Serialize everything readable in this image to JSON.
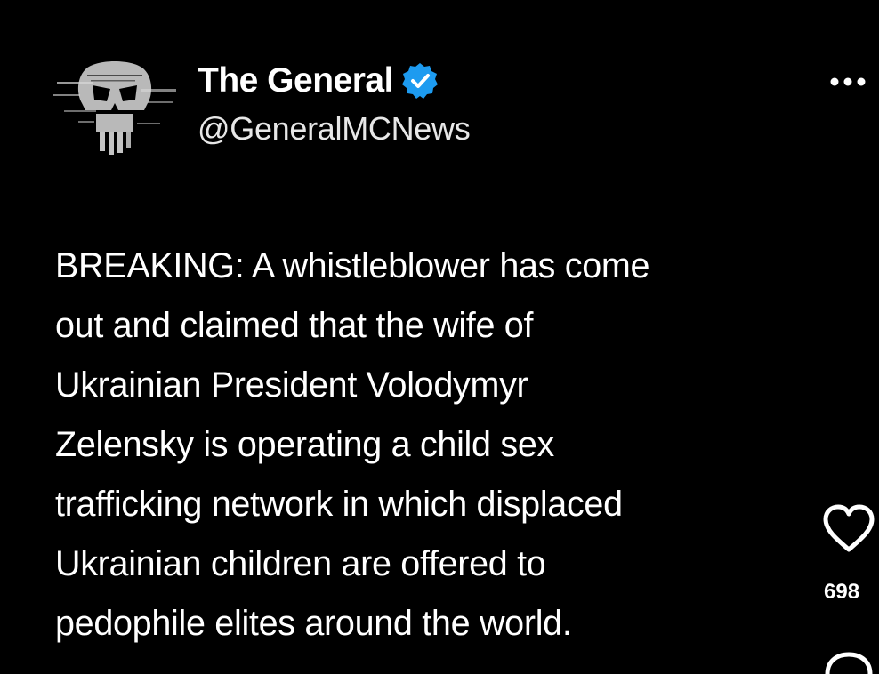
{
  "post": {
    "author": {
      "display_name": "The General",
      "handle": "@GeneralMCNews",
      "verified": true,
      "avatar_icon": "skull-logo"
    },
    "more_icon": "more-horizontal-icon",
    "text_lines": [
      "BREAKING: A whistleblower has come",
      "out and claimed that the wife of",
      "Ukrainian President Volodymyr",
      "Zelensky is operating a child sex",
      "trafficking network in which displaced",
      "Ukrainian children are offered to",
      "pedophile elites around the world."
    ]
  },
  "side_actions": {
    "like_icon": "heart-icon",
    "like_count": "698",
    "comment_icon": "comment-icon"
  },
  "colors": {
    "background": "#000000",
    "text": "#ffffff",
    "verified_badge": "#1d9bf0"
  }
}
